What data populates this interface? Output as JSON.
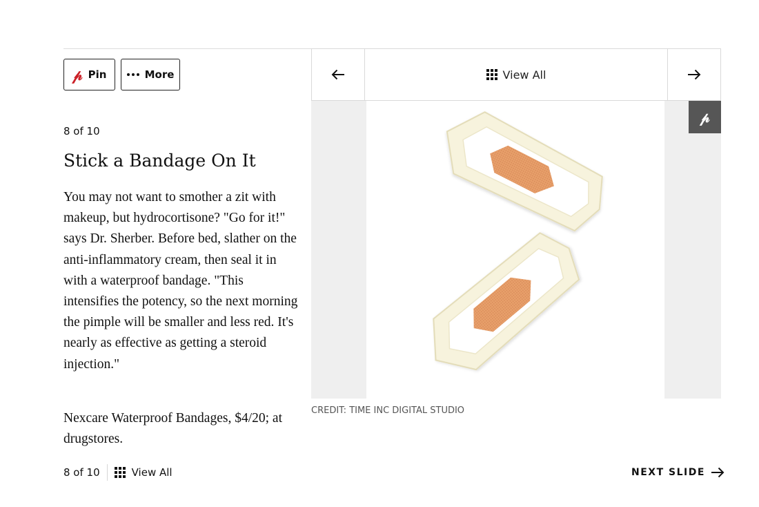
{
  "share": {
    "pin_label": "Pin",
    "more_label": "More"
  },
  "slide": {
    "counter": "8 of 10",
    "title": "Stick a Bandage On It",
    "body": "You may not want to smother a zit with makeup, but hydrocortisone? \"Go for it!\" says Dr. Sherber. Before bed, slather on the anti-inflammatory cream, then seal it in with a waterproof bandage. \"This intensifies the potency, so the next morning the pimple will be smaller and less red. It's nearly as effective as getting a steroid injection.\"",
    "product": "Nexcare Waterproof Bandages, $4/20; at drugstores.",
    "credit": "CREDIT: TIME INC DIGITAL STUDIO",
    "current": 8,
    "total": 10
  },
  "gallery_nav": {
    "view_all_label": "View All",
    "prev_icon": "arrow-left-icon",
    "next_icon": "arrow-right-icon",
    "grid_icon": "grid-icon"
  },
  "bottom_nav": {
    "counter": "8 of 10",
    "view_all_label": "View All",
    "next_slide_label": "NEXT SLIDE"
  },
  "colors": {
    "pinterest_red": "#cb2027",
    "pin_overlay_bg": "#565656",
    "frame_bg": "#efefef",
    "bandage_pad": "#e7a06a",
    "bandage_backing": "#f7f3dd"
  }
}
